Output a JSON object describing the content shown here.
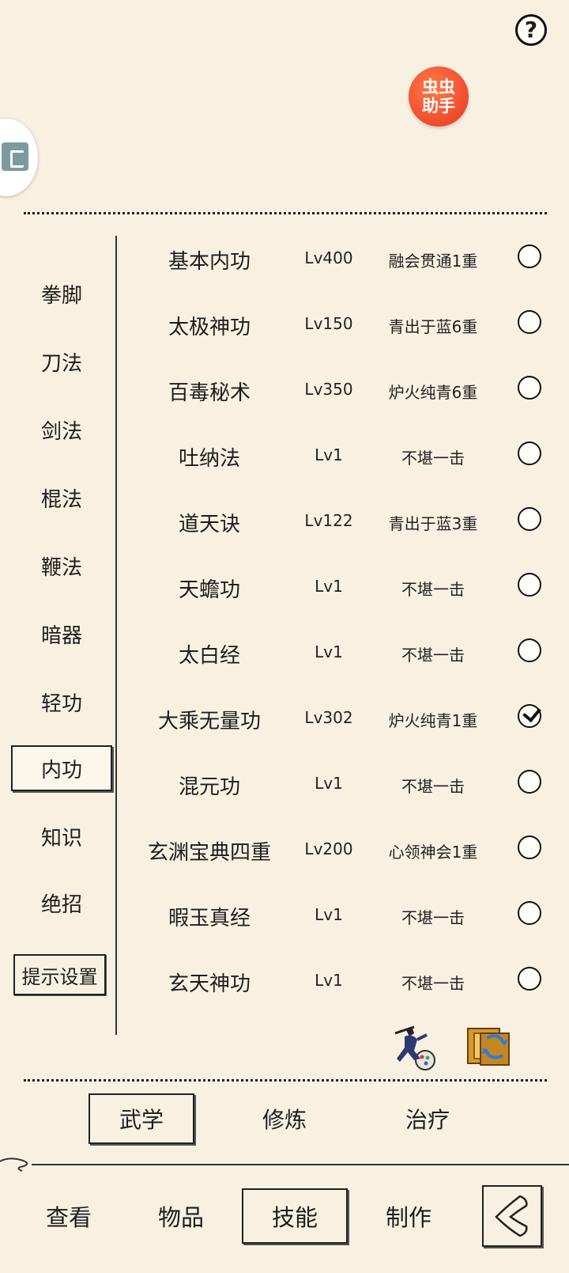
{
  "header": {
    "help_label": "?",
    "badge_line1": "虫虫",
    "badge_line2": "助手"
  },
  "sidebar": {
    "items": [
      {
        "label": "拳脚"
      },
      {
        "label": "刀法"
      },
      {
        "label": "剑法"
      },
      {
        "label": "棍法"
      },
      {
        "label": "鞭法"
      },
      {
        "label": "暗器"
      },
      {
        "label": "轻功"
      },
      {
        "label": "内功",
        "active": true
      },
      {
        "label": "知识"
      },
      {
        "label": "绝招"
      }
    ],
    "settings_label": "提示设置"
  },
  "skills": [
    {
      "name": "基本内功",
      "level": "Lv400",
      "rank": "融会贯通1重",
      "checked": false
    },
    {
      "name": "太极神功",
      "level": "Lv150",
      "rank": "青出于蓝6重",
      "checked": false
    },
    {
      "name": "百毒秘术",
      "level": "Lv350",
      "rank": "炉火纯青6重",
      "checked": false
    },
    {
      "name": "吐纳法",
      "level": "Lv1",
      "rank": "不堪一击",
      "checked": false
    },
    {
      "name": "道天诀",
      "level": "Lv122",
      "rank": "青出于蓝3重",
      "checked": false
    },
    {
      "name": "天蟾功",
      "level": "Lv1",
      "rank": "不堪一击",
      "checked": false
    },
    {
      "name": "太白经",
      "level": "Lv1",
      "rank": "不堪一击",
      "checked": false
    },
    {
      "name": "大乘无量功",
      "level": "Lv302",
      "rank": "炉火纯青1重",
      "checked": true
    },
    {
      "name": "混元功",
      "level": "Lv1",
      "rank": "不堪一击",
      "checked": false
    },
    {
      "name": "玄渊宝典四重",
      "level": "Lv200",
      "rank": "心领神会1重",
      "checked": false
    },
    {
      "name": "暇玉真经",
      "level": "Lv1",
      "rank": "不堪一击",
      "checked": false
    },
    {
      "name": "玄天神功",
      "level": "Lv1",
      "rank": "不堪一击",
      "checked": false
    }
  ],
  "subtabs": [
    {
      "label": "武学",
      "active": true
    },
    {
      "label": "修炼"
    },
    {
      "label": "治疗"
    }
  ],
  "bottom_nav": [
    {
      "label": "查看"
    },
    {
      "label": "物品"
    },
    {
      "label": "技能",
      "active": true
    },
    {
      "label": "制作"
    }
  ],
  "icons": {
    "practice": "martial-artist-icon",
    "exchange": "book-swap-icon",
    "back": "back-arrow-icon"
  },
  "colors": {
    "background": "#f8f1e2",
    "badge": "#e8371f"
  }
}
